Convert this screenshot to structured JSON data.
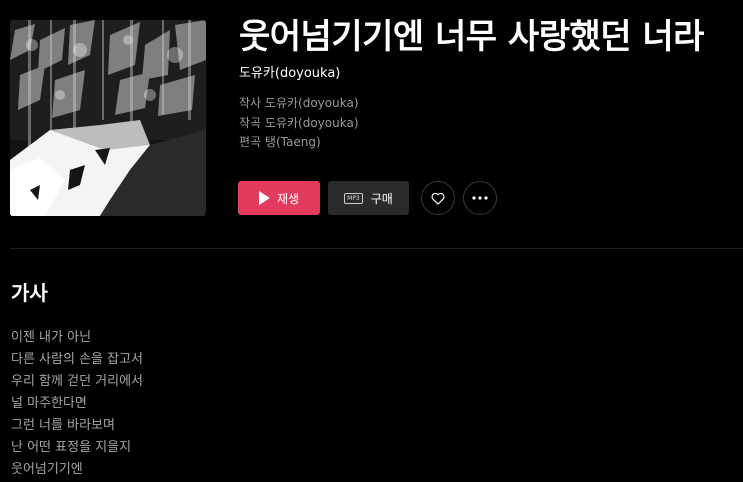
{
  "song": {
    "title": "웃어넘기기엔 너무 사랑했던 너라",
    "artist": "도유카(doyouka)"
  },
  "credits": [
    {
      "role": "작사",
      "name": "도유카(doyouka)"
    },
    {
      "role": "작곡",
      "name": "도유카(doyouka)"
    },
    {
      "role": "편곡",
      "name": "탱(Taeng)"
    }
  ],
  "actions": {
    "play_label": "재생",
    "buy_label": "구매",
    "mp3_badge": "MP3",
    "like_icon": "heart-icon",
    "more_icon": "more-horizontal-icon",
    "play_color": "#e33b5d"
  },
  "lyrics": {
    "heading": "가사",
    "lines": [
      "이젠 내가 아닌",
      "다른 사람의 손을 잡고서",
      "우리 함께 걷던 거리에서",
      "널 마주한다면",
      "그런 너를 바라보며",
      "난 어떤 표정을 지을지",
      "웃어넘기기엔"
    ]
  }
}
